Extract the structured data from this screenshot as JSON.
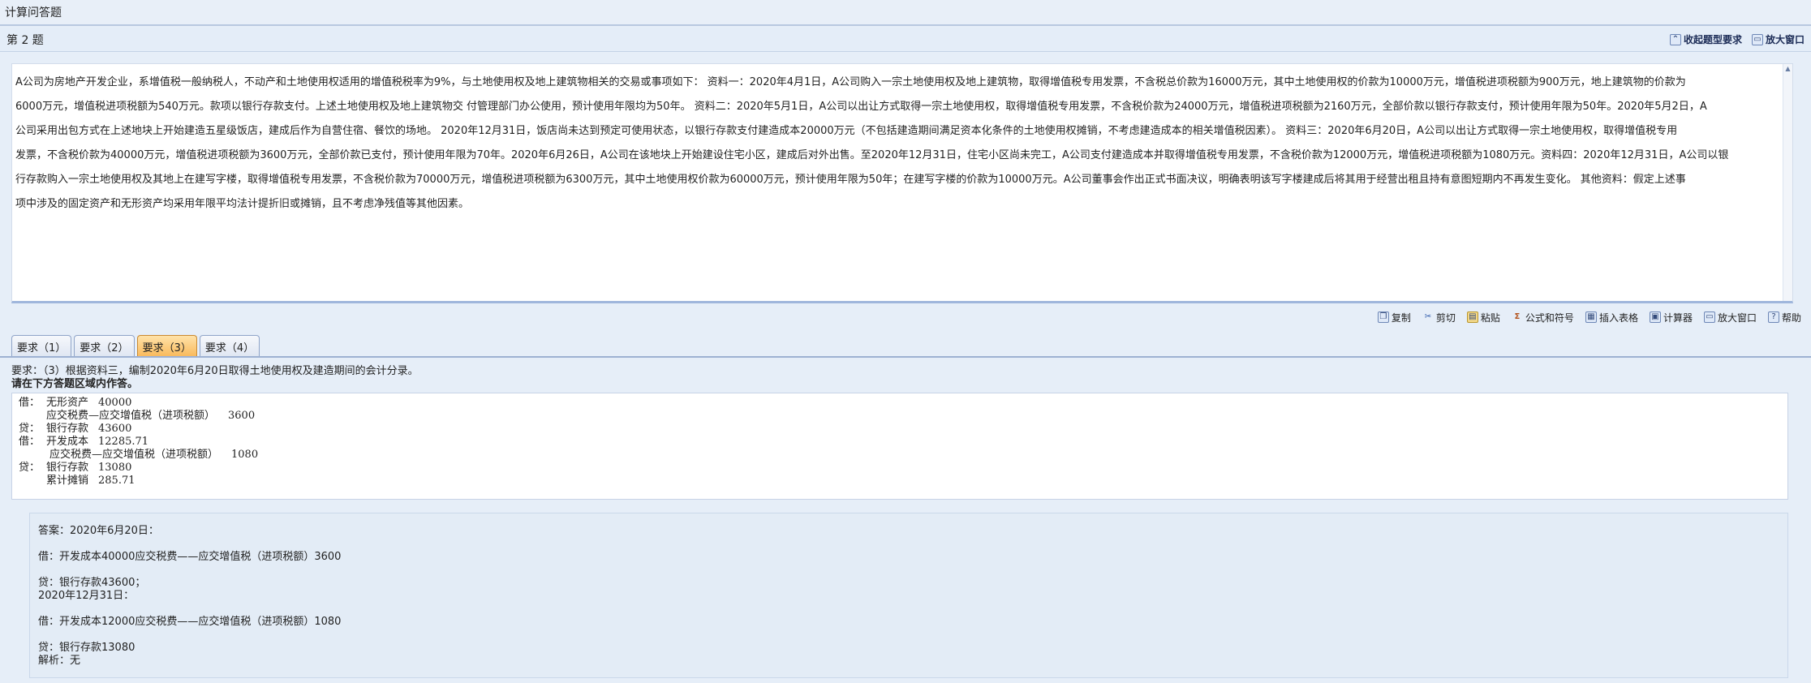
{
  "topbar": {
    "title": "计算问答题"
  },
  "question": {
    "number_label": "第 2 题",
    "links": [
      {
        "label": "收起题型要求",
        "icon": "collapse-icon"
      },
      {
        "label": "放大窗口",
        "icon": "maximize-window-icon"
      }
    ],
    "stem_lines": [
      "A公司为房地产开发企业，系增值税一般纳税人，不动产和土地使用权适用的增值税税率为9%，与土地使用权及地上建筑物相关的交易或事项如下： 资料一：2020年4月1日，A公司购入一宗土地使用权及地上建筑物，取得增值税专用发票，不含税总价款为16000万元，其中土地使用权的价款为10000万元，增值税进项税额为900万元，地上建筑物的价款为",
      "6000万元，增值税进项税额为540万元。款项以银行存款支付。上述土地使用权及地上建筑物交 付管理部门办公使用，预计使用年限均为50年。 资料二：2020年5月1日，A公司以出让方式取得一宗土地使用权，取得增值税专用发票，不含税价款为24000万元，增值税进项税额为2160万元，全部价款以银行存款支付，预计使用年限为50年。2020年5月2日，A",
      "公司采用出包方式在上述地块上开始建造五星级饭店，建成后作为自营住宿、餐饮的场地。 2020年12月31日，饭店尚未达到预定可使用状态，以银行存款支付建造成本20000万元（不包括建造期间满足资本化条件的土地使用权摊销，不考虑建造成本的相关增值税因素）。 资料三：2020年6月20日，A公司以出让方式取得一宗土地使用权，取得增值税专用",
      "发票，不含税价款为40000万元，增值税进项税额为3600万元，全部价款已支付，预计使用年限为70年。2020年6月26日，A公司在该地块上开始建设住宅小区，建成后对外出售。至2020年12月31日，住宅小区尚未完工，A公司支付建造成本并取得增值税专用发票，不含税价款为12000万元，增值税进项税额为1080万元。资料四：2020年12月31日，A公司以银",
      "行存款购入一宗土地使用权及其地上在建写字楼，取得增值税专用发票，不含税价款为70000万元，增值税进项税额为6300万元，其中土地使用权价款为60000万元，预计使用年限为50年；在建写字楼的价款为10000万元。A公司董事会作出正式书面决议，明确表明该写字楼建成后将其用于经营出租且持有意图短期内不再发生变化。 其他资料：假定上述事",
      "项中涉及的固定资产和无形资产均采用年限平均法计提折旧或摊销，且不考虑净残值等其他因素。"
    ]
  },
  "toolbar": {
    "items": [
      {
        "label": "复制",
        "icon": "copy-icon"
      },
      {
        "label": "剪切",
        "icon": "cut-icon"
      },
      {
        "label": "粘贴",
        "icon": "paste-icon"
      },
      {
        "label": "公式和符号",
        "icon": "sigma-icon"
      },
      {
        "label": "插入表格",
        "icon": "table-icon"
      },
      {
        "label": "计算器",
        "icon": "calculator-icon"
      },
      {
        "label": "放大窗口",
        "icon": "maximize-window-icon"
      },
      {
        "label": "帮助",
        "icon": "help-icon"
      }
    ]
  },
  "tabs": [
    {
      "label": "要求（1）",
      "active": false
    },
    {
      "label": "要求（2）",
      "active": false
    },
    {
      "label": "要求（3）",
      "active": true
    },
    {
      "label": "要求（4）",
      "active": false
    }
  ],
  "requirement": {
    "text": "要求：（3）根据资料三，编制2020年6月20日取得土地使用权及建造期间的会计分录。",
    "hint": "请在下方答题区域内作答。"
  },
  "user_answer": {
    "lines": [
      {
        "label": "借：",
        "account": "无形资产",
        "amount": "40000"
      },
      {
        "label": "",
        "account": "应交税费—应交增值税（进项税额）",
        "amount": "3600"
      },
      {
        "label": "贷：",
        "account": "银行存款",
        "amount": "43600"
      },
      {
        "label": "借：",
        "account": "开发成本",
        "amount": "12285.71"
      },
      {
        "label": "",
        "account": "应交税费—应交增值税（进项税额）",
        "amount": "1080"
      },
      {
        "label": "贷：",
        "account": "银行存款",
        "amount": "13080"
      },
      {
        "label": "",
        "account": "累计摊销",
        "amount": "285.71"
      }
    ]
  },
  "reference": {
    "answer_heading": "答案：2020年6月20日：",
    "line1": "借：开发成本40000应交税费——应交增值税（进项税额）3600",
    "line2": "贷：银行存款43600；",
    "date2": "2020年12月31日：",
    "line3": "借：开发成本12000应交税费——应交增值税（进项税额）1080",
    "line4": "贷：银行存款13080",
    "analysis": "解析：无"
  }
}
